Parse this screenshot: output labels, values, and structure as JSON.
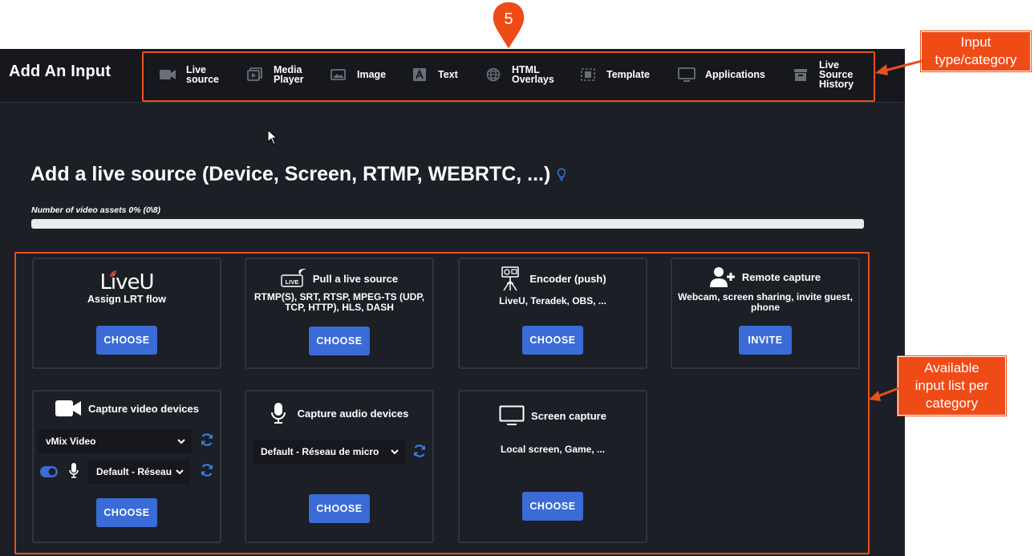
{
  "app": {
    "title": "Add An Input",
    "tabs": [
      {
        "label": "Live\nsource",
        "icon": "camera-icon",
        "active": true
      },
      {
        "label": "Media\nPlayer",
        "icon": "media-player-icon"
      },
      {
        "label": "Image",
        "icon": "image-icon"
      },
      {
        "label": "Text",
        "icon": "text-icon"
      },
      {
        "label": "HTML\nOverlays",
        "icon": "globe-icon"
      },
      {
        "label": "Template",
        "icon": "template-icon"
      },
      {
        "label": "Applications",
        "icon": "monitor-icon"
      },
      {
        "label": "Live\nSource\nHistory",
        "icon": "archive-icon"
      }
    ]
  },
  "main": {
    "heading": "Add a live source (Device, Screen, RTMP, WEBRTC, ...)",
    "assets_label": "Number of video assets 0% (0\\8)",
    "assets_progress": 0
  },
  "cards": {
    "liveu": {
      "logo": "LiveU",
      "title": "Assign LRT flow",
      "button": "CHOOSE"
    },
    "pull": {
      "title": "Pull a live source",
      "desc": "RTMP(S), SRT, RTSP, MPEG-TS (UDP, TCP, HTTP), HLS, DASH",
      "button": "CHOOSE",
      "icon_text": "LIVE"
    },
    "encoder": {
      "title": "Encoder (push)",
      "desc": "LiveU, Teradek, OBS, ...",
      "button": "CHOOSE"
    },
    "remote": {
      "title": "Remote capture",
      "desc": "Webcam, screen sharing, invite guest, phone",
      "button": "INVITE"
    },
    "video": {
      "title": "Capture video devices",
      "device": "vMix Video",
      "audio_device": "Default - Réseau de micro",
      "button": "CHOOSE"
    },
    "audio": {
      "title": "Capture audio devices",
      "device": "Default - Réseau de micro",
      "button": "CHOOSE"
    },
    "screen": {
      "title": "Screen capture",
      "desc": "Local screen, Game, ...",
      "button": "CHOOSE"
    }
  },
  "annotations": {
    "step_number": "5",
    "callout_category": "Input\ntype/category",
    "callout_list": "Available\ninput list per\ncategory",
    "accent_color": "#e8501e"
  }
}
